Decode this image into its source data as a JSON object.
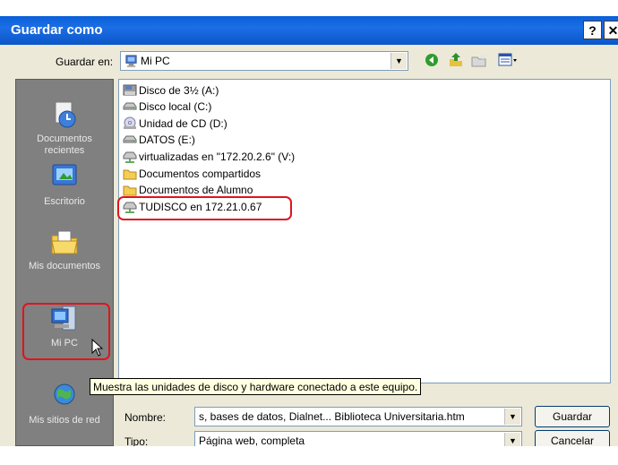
{
  "window": {
    "title": "Guardar como",
    "help_label": "?",
    "close_label": "✕"
  },
  "save_in": {
    "label": "Guardar en:",
    "value": "Mi PC",
    "icon": "my-computer-icon"
  },
  "toolbar": [
    "back-icon",
    "up-folder-icon",
    "new-folder-icon",
    "view-menu-icon"
  ],
  "places": [
    {
      "label": "Documentos recientes",
      "icon": "recent-documents-icon"
    },
    {
      "label": "Escritorio",
      "icon": "desktop-icon"
    },
    {
      "label": "Mis documentos",
      "icon": "my-documents-icon"
    },
    {
      "label": "Mi PC",
      "icon": "my-computer-icon"
    },
    {
      "label": "Mis sitios de red",
      "icon": "network-places-icon"
    }
  ],
  "items": [
    {
      "label": "Disco de 3½ (A:)",
      "icon": "floppy-drive-icon"
    },
    {
      "label": "Disco local (C:)",
      "icon": "hard-drive-icon"
    },
    {
      "label": "Unidad de CD (D:)",
      "icon": "cd-drive-icon"
    },
    {
      "label": "DATOS (E:)",
      "icon": "hard-drive-icon"
    },
    {
      "label": "virtualizadas en \"172.20.2.6\" (V:)",
      "icon": "network-drive-icon"
    },
    {
      "label": "Documentos compartidos",
      "icon": "folder-icon"
    },
    {
      "label": "Documentos de Alumno",
      "icon": "folder-icon"
    },
    {
      "label": "TUDISCO en 172.21.0.67",
      "icon": "network-drive-icon"
    }
  ],
  "tooltip": "Muestra las unidades de disco y hardware conectado a este equipo.",
  "filename": {
    "label": "Nombre:",
    "value": "s, bases de datos, Dialnet... Biblioteca Universitaria.htm"
  },
  "filetype": {
    "label": "Tipo:",
    "value": "Página web, completa"
  },
  "buttons": {
    "save": "Guardar",
    "cancel": "Cancelar"
  },
  "colors": {
    "title_bar": "#0b5ad6",
    "places_bar": "#808080",
    "highlight": "#e0141e",
    "tooltip_bg": "#ffffe1"
  }
}
